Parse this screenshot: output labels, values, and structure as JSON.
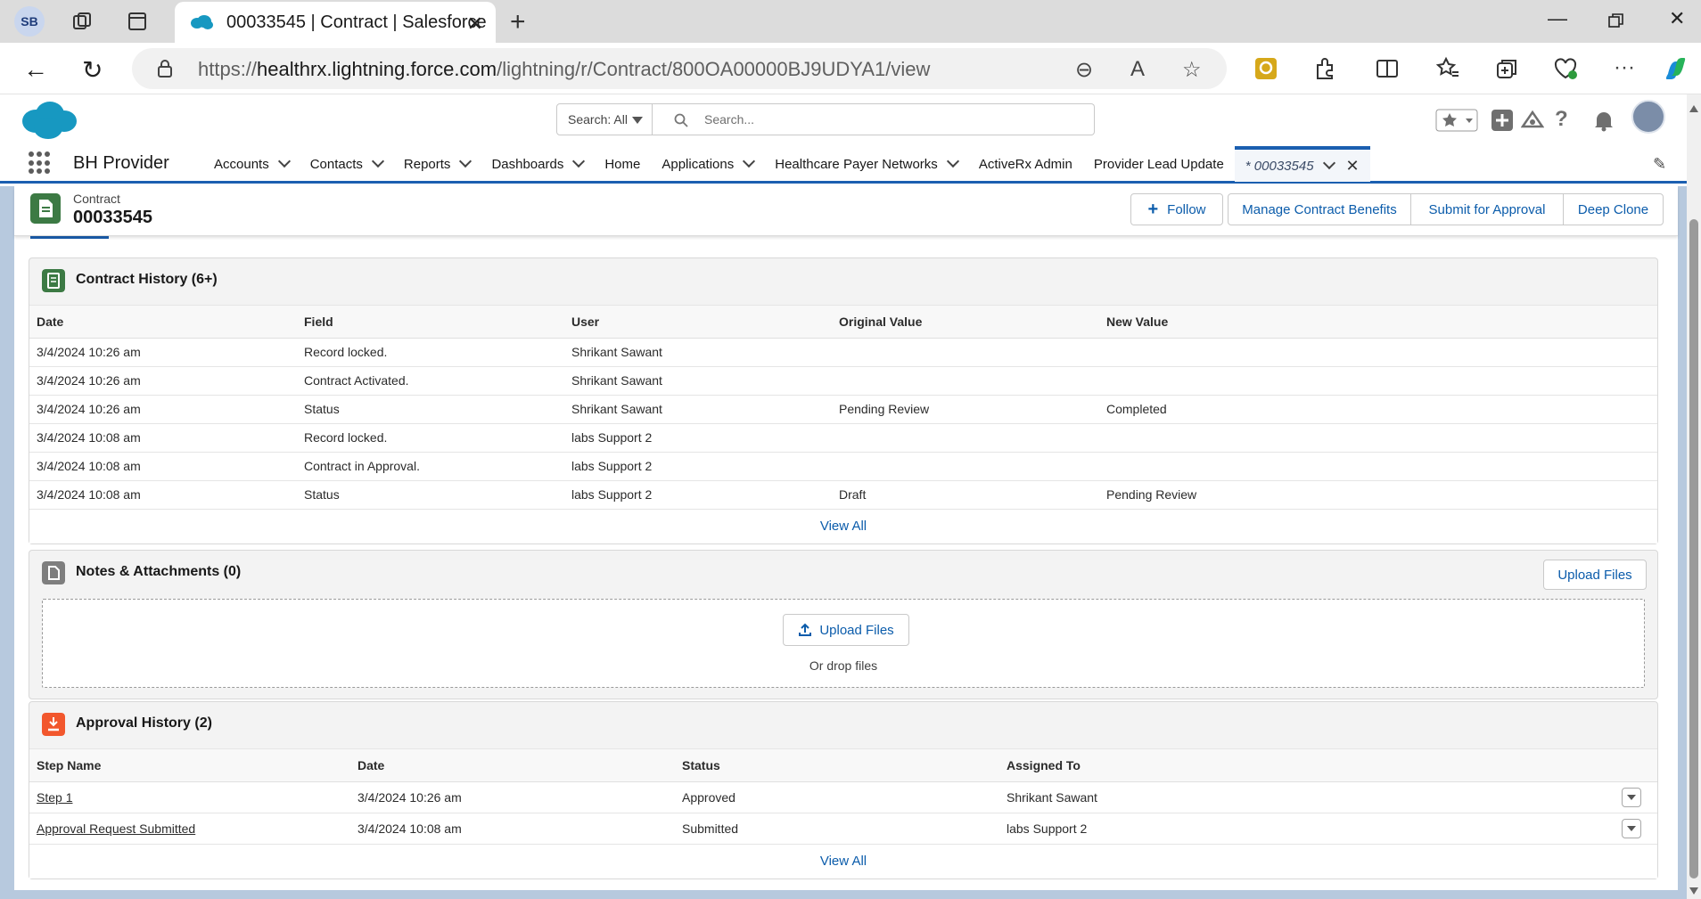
{
  "browser": {
    "profile_initials": "SB",
    "tab_title": "00033545 | Contract | Salesforce",
    "url_prefix": "https://",
    "url_domain": "healthrx.lightning.force.com",
    "url_path": "/lightning/r/Contract/800OA00000BJ9UDYA1/view"
  },
  "sf_header": {
    "search_scope": "Search: All",
    "search_placeholder": "Search..."
  },
  "nav": {
    "app_name": "BH Provider",
    "items": [
      {
        "label": "Accounts",
        "has_menu": true
      },
      {
        "label": "Contacts",
        "has_menu": true
      },
      {
        "label": "Reports",
        "has_menu": true
      },
      {
        "label": "Dashboards",
        "has_menu": true
      },
      {
        "label": "Home",
        "has_menu": false
      },
      {
        "label": "Applications",
        "has_menu": true
      },
      {
        "label": "Healthcare Payer Networks",
        "has_menu": true
      },
      {
        "label": "ActiveRx Admin",
        "has_menu": false
      },
      {
        "label": "Provider Lead Update",
        "has_menu": false
      }
    ],
    "active_tab": "* 00033545"
  },
  "record": {
    "type": "Contract",
    "name": "00033545",
    "follow_label": "Follow",
    "actions": [
      "Manage Contract Benefits",
      "Submit for Approval",
      "Deep Clone"
    ]
  },
  "contract_history": {
    "title": "Contract History (6+)",
    "columns": [
      "Date",
      "Field",
      "User",
      "Original Value",
      "New Value"
    ],
    "rows": [
      [
        "3/4/2024 10:26 am",
        "Record locked.",
        "Shrikant Sawant",
        "",
        ""
      ],
      [
        "3/4/2024 10:26 am",
        "Contract Activated.",
        "Shrikant Sawant",
        "",
        ""
      ],
      [
        "3/4/2024 10:26 am",
        "Status",
        "Shrikant Sawant",
        "Pending Review",
        "Completed"
      ],
      [
        "3/4/2024 10:08 am",
        "Record locked.",
        "labs Support 2",
        "",
        ""
      ],
      [
        "3/4/2024 10:08 am",
        "Contract in Approval.",
        "labs Support 2",
        "",
        ""
      ],
      [
        "3/4/2024 10:08 am",
        "Status",
        "labs Support 2",
        "Draft",
        "Pending Review"
      ]
    ],
    "view_all": "View All"
  },
  "notes": {
    "title": "Notes & Attachments (0)",
    "upload_label": "Upload Files",
    "dz_upload_label": "Upload Files",
    "drop_text": "Or drop files"
  },
  "approval_history": {
    "title": "Approval History (2)",
    "columns": [
      "Step Name",
      "Date",
      "Status",
      "Assigned To"
    ],
    "rows": [
      [
        "Step 1",
        "3/4/2024 10:26 am",
        "Approved",
        "Shrikant Sawant"
      ],
      [
        "Approval Request Submitted",
        "3/4/2024 10:08 am",
        "Submitted",
        "labs Support 2"
      ]
    ],
    "view_all": "View All"
  },
  "colors": {
    "brand_blue": "#1b5fb0",
    "link": "#0b5cab",
    "contract_icon": "#3c7a44",
    "notes_icon": "#7e7e7e",
    "approval_icon": "#f2572d"
  }
}
